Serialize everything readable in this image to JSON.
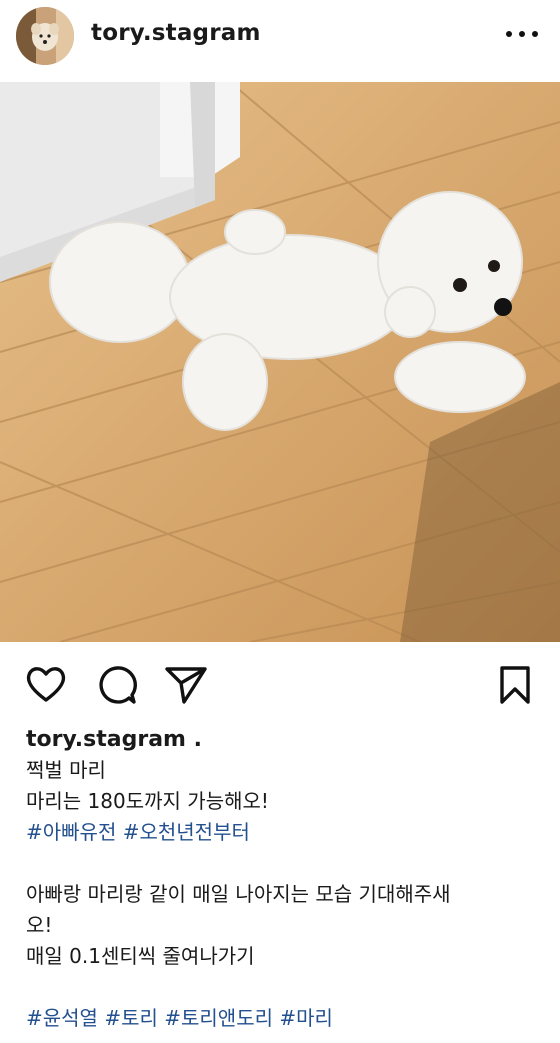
{
  "header": {
    "username": "tory.stagram",
    "more_icon": "more-horizontal-icon"
  },
  "post": {
    "image_description_icon": "photo"
  },
  "actions": {
    "icons": [
      "heart-icon",
      "comment-icon",
      "share-icon",
      "bookmark-icon"
    ]
  },
  "caption": {
    "username_line": "tory.stagram .",
    "line1": "쩍벌 마리",
    "line2": "마리는 180도까지 가능해오!",
    "tags1": [
      "#아빠유전",
      "#오천년전부터"
    ],
    "line3": "아빠랑 마리랑 같이 매일 나아지는 모습 기대해주새",
    "line4": "오!",
    "line5": "매일 0.1센티씩 줄여나가기",
    "tags2": [
      "#윤석열",
      "#토리",
      "#토리앤도리",
      "#마리"
    ]
  },
  "colors": {
    "hashtag": "#23508e",
    "floor": "#d9ad72",
    "dog": "#f4f2ef"
  }
}
